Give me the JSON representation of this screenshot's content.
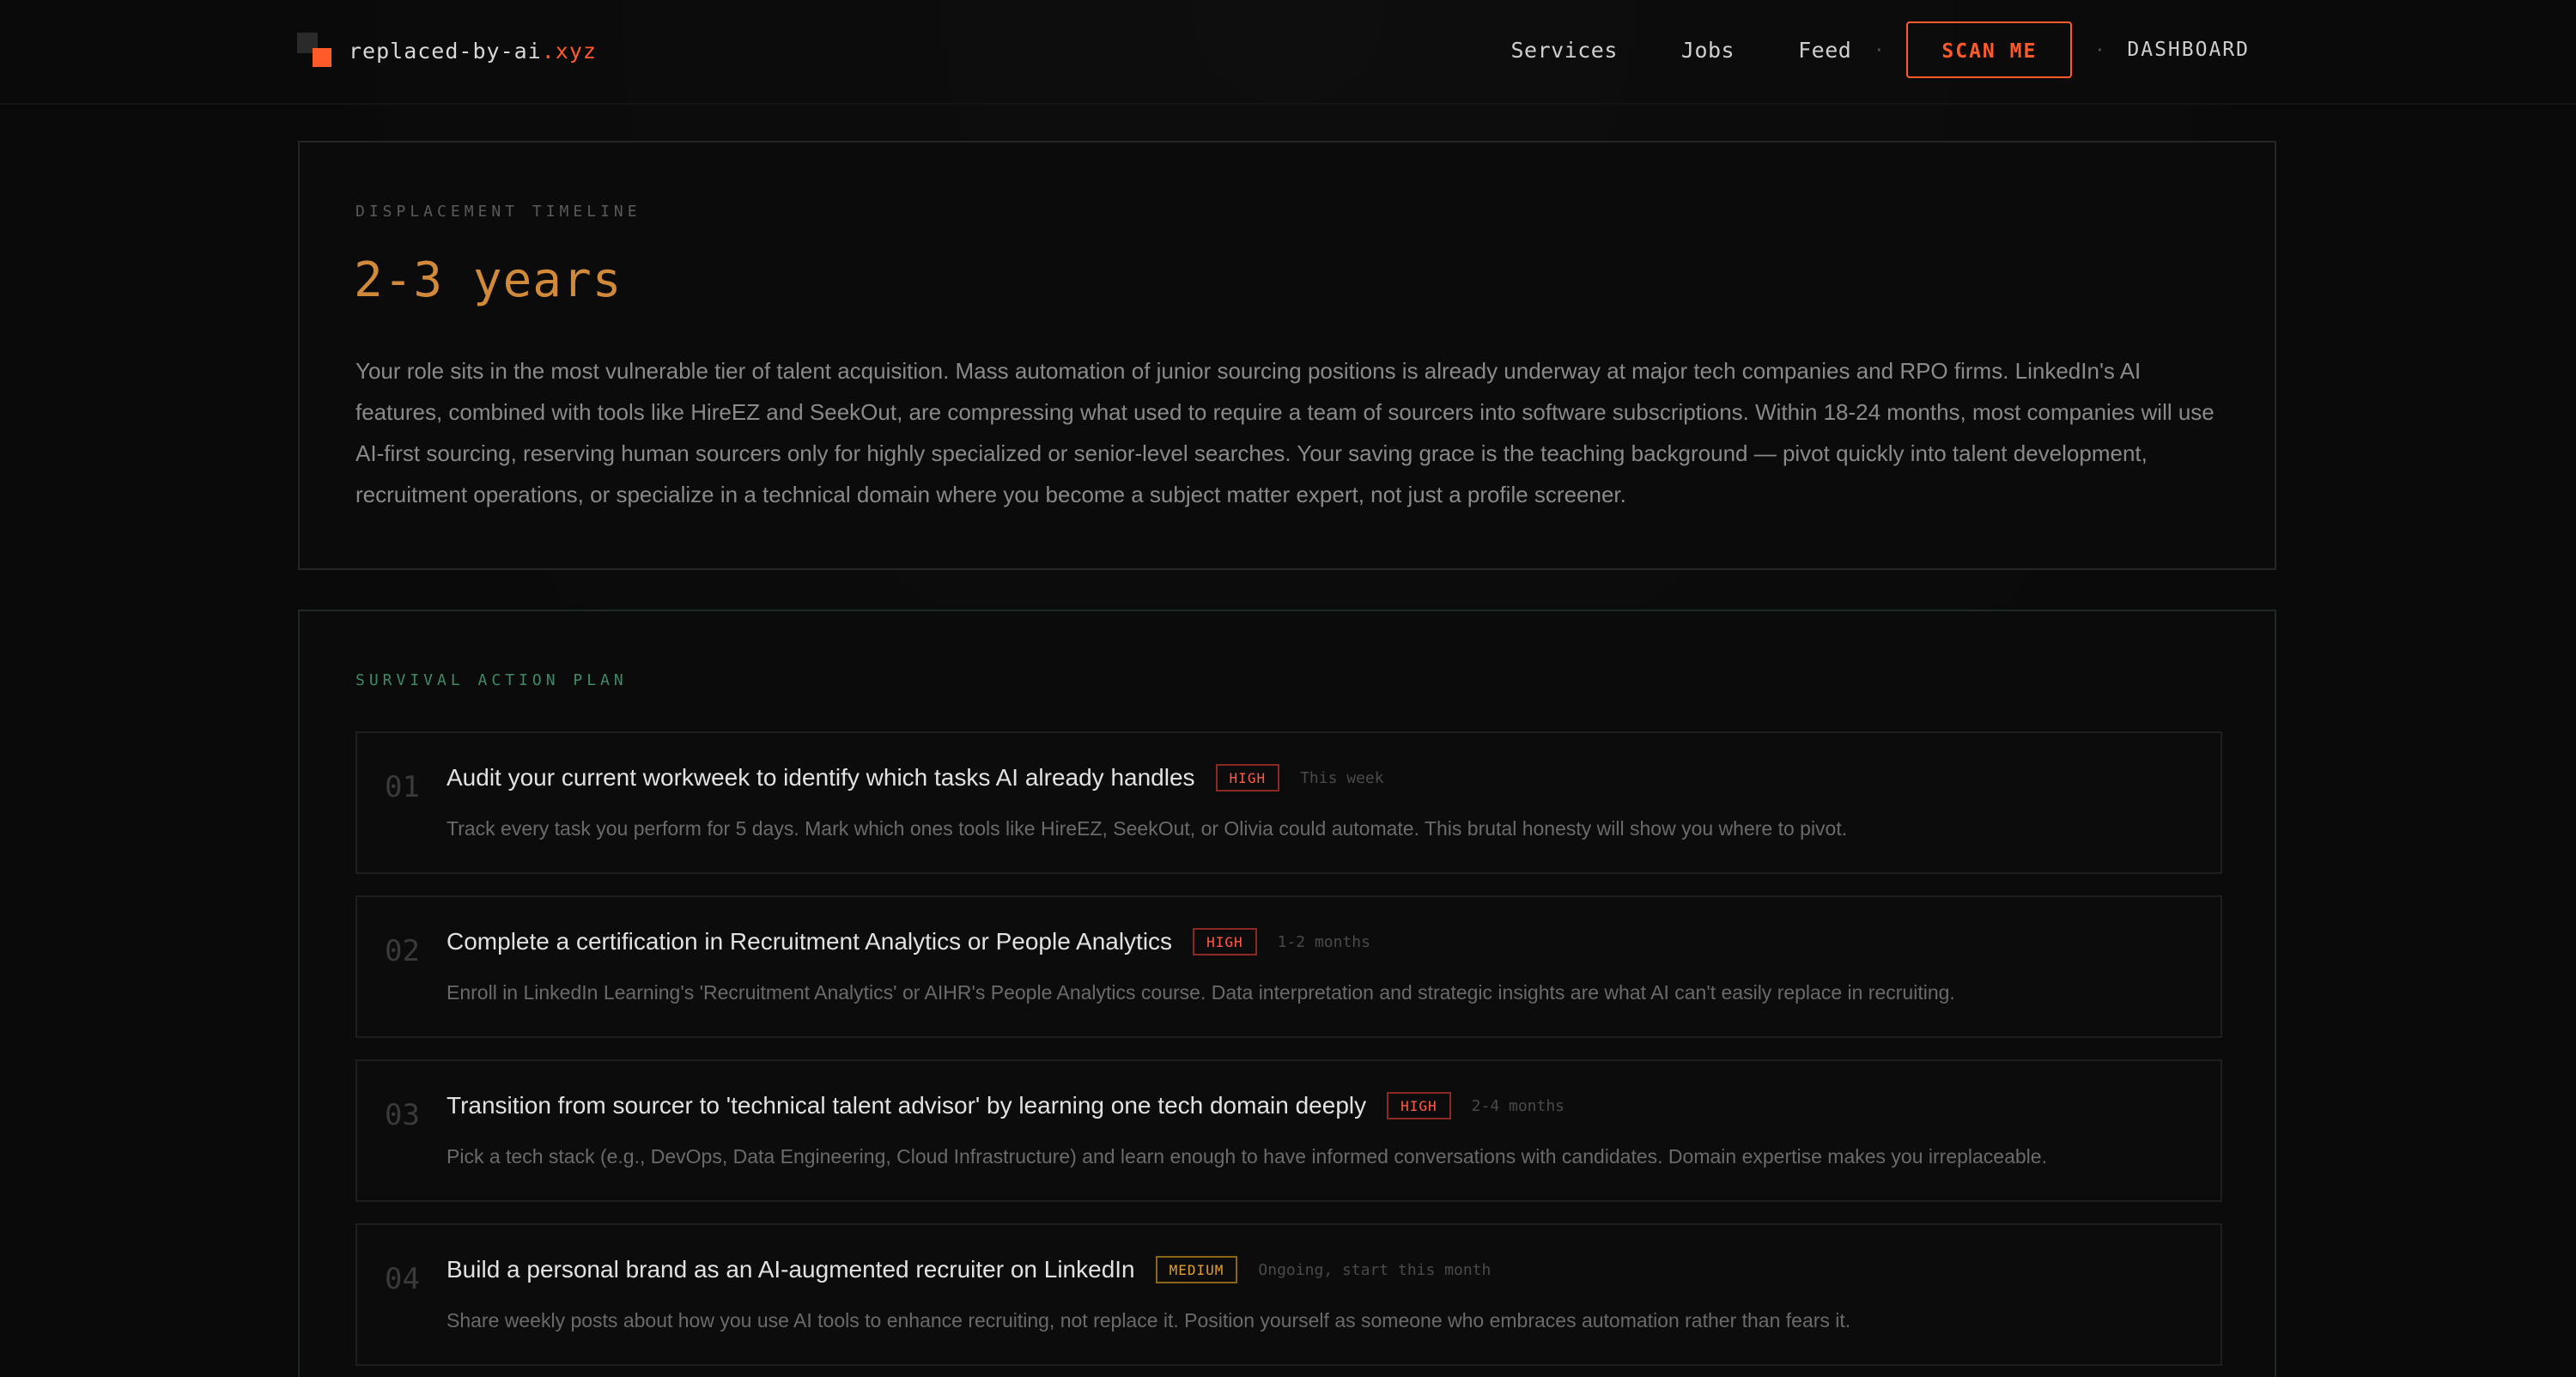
{
  "brand": {
    "name": "replaced-by-ai",
    "tld": ".xyz"
  },
  "nav": {
    "services": "Services",
    "jobs": "Jobs",
    "feed": "Feed",
    "separator": "·",
    "scan": "SCAN ME",
    "dashboard": "DASHBOARD"
  },
  "timeline": {
    "eyebrow": "DISPLACEMENT TIMELINE",
    "value": "2-3 years",
    "body": "Your role sits in the most vulnerable tier of talent acquisition. Mass automation of junior sourcing positions is already underway at major tech companies and RPO firms. LinkedIn's AI features, combined with tools like HireEZ and SeekOut, are compressing what used to require a team of sourcers into software subscriptions. Within 18-24 months, most companies will use AI-first sourcing, reserving human sourcers only for highly specialized or senior-level searches. Your saving grace is the teaching background — pivot quickly into talent development, recruitment operations, or specialize in a technical domain where you become a subject matter expert, not just a profile screener."
  },
  "survival": {
    "eyebrow": "SURVIVAL ACTION PLAN",
    "items": [
      {
        "num": "01",
        "title": "Audit your current workweek to identify which tasks AI already handles",
        "priority": "HIGH",
        "time": "This week",
        "desc": "Track every task you perform for 5 days. Mark which ones tools like HireEZ, SeekOut, or Olivia could automate. This brutal honesty will show you where to pivot."
      },
      {
        "num": "02",
        "title": "Complete a certification in Recruitment Analytics or People Analytics",
        "priority": "HIGH",
        "time": "1-2 months",
        "desc": "Enroll in LinkedIn Learning's 'Recruitment Analytics' or AIHR's People Analytics course. Data interpretation and strategic insights are what AI can't easily replace in recruiting."
      },
      {
        "num": "03",
        "title": "Transition from sourcer to 'technical talent advisor' by learning one tech domain deeply",
        "priority": "HIGH",
        "time": "2-4 months",
        "desc": "Pick a tech stack (e.g., DevOps, Data Engineering, Cloud Infrastructure) and learn enough to have informed conversations with candidates. Domain expertise makes you irreplaceable."
      },
      {
        "num": "04",
        "title": "Build a personal brand as an AI-augmented recruiter on LinkedIn",
        "priority": "MEDIUM",
        "time": "Ongoing, start this month",
        "desc": "Share weekly posts about how you use AI tools to enhance recruiting, not replace it. Position yourself as someone who embraces automation rather than fears it."
      }
    ]
  },
  "colors": {
    "accent": "#ff5a2a",
    "timeline_value": "#d08a3a",
    "survival_eyebrow": "#3f8a66",
    "badge_high": "#ff5a4a",
    "badge_medium": "#e0a030"
  }
}
